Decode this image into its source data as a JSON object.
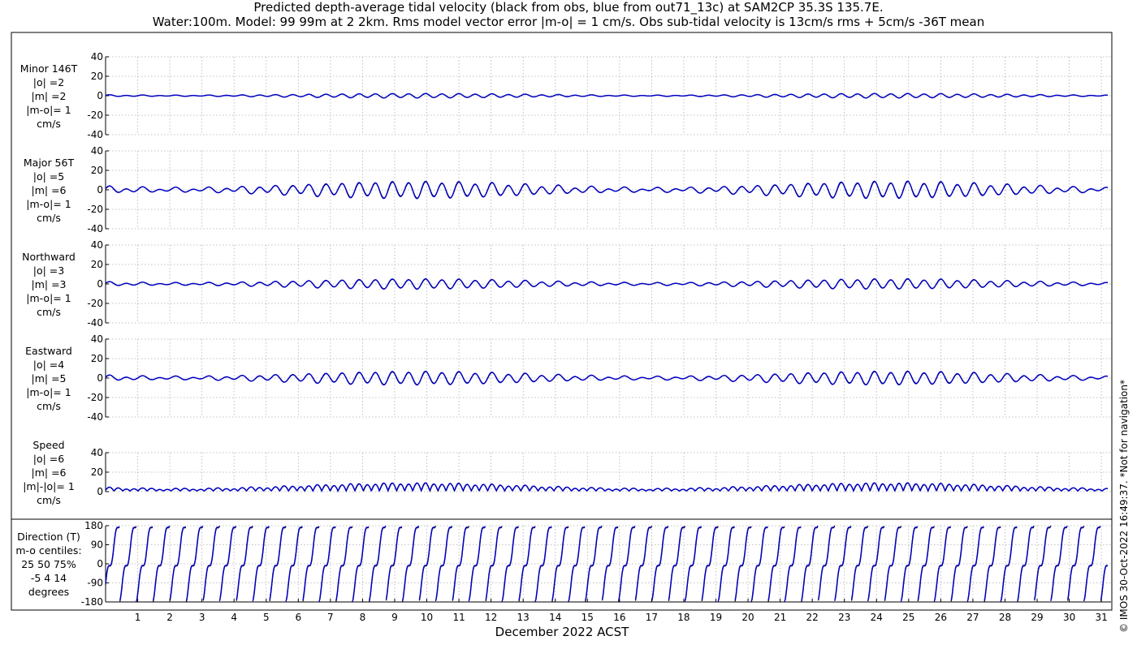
{
  "title_line1": "Predicted depth-average tidal velocity (black from obs, blue from out71_13c) at SAM2CP 35.3S 135.7E.",
  "title_line2": "Water:100m. Model: 99 99m at 2 2km. Rms model vector error |m-o| = 1 cm/s. Obs sub-tidal velocity is 13cm/s rms + 5cm/s -36T mean",
  "copyright": "© IMOS 30-Oct-2022 16:49:37. *Not for navigation*",
  "colors": {
    "obs": "#000000",
    "model": "#0000cc",
    "grid": "#b0b0b0"
  },
  "chart_data": [
    {
      "type": "line",
      "name": "minor",
      "label_lines": [
        "Minor 146T",
        "|o| =2",
        "|m| =2",
        "|m-o|= 1",
        "cm/s"
      ],
      "ylim": [
        -40,
        40
      ],
      "yticks": [
        40,
        20,
        0,
        -20,
        -40
      ],
      "ytick_labels": [
        "40",
        "20",
        "0",
        "-20",
        "-40"
      ],
      "amp_m2": 1.6,
      "amp_s2": 0.8,
      "mean": 0,
      "series": [
        {
          "name": "black from obs"
        },
        {
          "name": "blue from out71_13c"
        }
      ]
    },
    {
      "type": "line",
      "name": "major",
      "label_lines": [
        "Major 56T",
        "|o| =5",
        "|m| =6",
        "|m-o|= 1",
        "cm/s"
      ],
      "ylim": [
        -40,
        40
      ],
      "yticks": [
        40,
        20,
        0,
        -20,
        -40
      ],
      "ytick_labels": [
        "40",
        "20",
        "0",
        "-20",
        "-40"
      ],
      "amp_m2": 6,
      "amp_s2": 3.6,
      "mean": 0,
      "series": [
        {
          "name": "black from obs"
        },
        {
          "name": "blue from out71_13c"
        }
      ]
    },
    {
      "type": "line",
      "name": "northward",
      "label_lines": [
        "Northward",
        "|o| =3",
        "|m| =3",
        "|m-o|= 1",
        "cm/s"
      ],
      "ylim": [
        -40,
        40
      ],
      "yticks": [
        40,
        20,
        0,
        -20,
        -40
      ],
      "ytick_labels": [
        "40",
        "20",
        "0",
        "-20",
        "-40"
      ],
      "amp_m2": 3.6,
      "amp_s2": 2,
      "mean": 0,
      "series": [
        {
          "name": "black from obs"
        },
        {
          "name": "blue from out71_13c"
        }
      ]
    },
    {
      "type": "line",
      "name": "eastward",
      "label_lines": [
        "Eastward",
        "|o| =4",
        "|m| =5",
        "|m-o|= 1",
        "cm/s"
      ],
      "ylim": [
        -40,
        40
      ],
      "yticks": [
        40,
        20,
        0,
        -20,
        -40
      ],
      "ytick_labels": [
        "40",
        "20",
        "0",
        "-20",
        "-40"
      ],
      "amp_m2": 4.8,
      "amp_s2": 2.6,
      "mean": 0,
      "series": [
        {
          "name": "black from obs"
        },
        {
          "name": "blue from out71_13c"
        }
      ]
    },
    {
      "type": "line",
      "name": "speed",
      "label_lines": [
        "Speed",
        "|o| =6",
        "|m| =6",
        "|m|-|o|= 1",
        "cm/s"
      ],
      "ylim": [
        0,
        40
      ],
      "yticks": [
        40,
        20,
        0
      ],
      "ytick_labels": [
        "40",
        "20",
        "0"
      ],
      "amp_m2": 6,
      "amp_s2": 3.4,
      "mean": 0,
      "series": [
        {
          "name": "black from obs"
        },
        {
          "name": "blue from out71_13c"
        }
      ]
    },
    {
      "type": "line",
      "name": "direction",
      "label_lines": [
        "Direction (T)",
        "m-o centiles:",
        "25  50  75%",
        "-5   4  14",
        "degrees"
      ],
      "ylim": [
        -180,
        180
      ],
      "yticks": [
        180,
        90,
        0,
        -90,
        -180
      ],
      "ytick_labels": [
        "180",
        "90",
        "0",
        "-90",
        "-180"
      ],
      "series": [
        {
          "name": "black from obs"
        },
        {
          "name": "blue from out71_13c"
        }
      ]
    }
  ],
  "xaxis": {
    "label": "December 2022 ACST",
    "xlim": [
      0,
      31.3
    ],
    "ticks": [
      1,
      2,
      3,
      4,
      5,
      6,
      7,
      8,
      9,
      10,
      11,
      12,
      13,
      14,
      15,
      16,
      17,
      18,
      19,
      20,
      21,
      22,
      23,
      24,
      25,
      26,
      27,
      28,
      29,
      30,
      31
    ],
    "tick_labels": [
      "1",
      "2",
      "3",
      "4",
      "5",
      "6",
      "7",
      "8",
      "9",
      "10",
      "11",
      "12",
      "13",
      "14",
      "15",
      "16",
      "17",
      "18",
      "19",
      "20",
      "21",
      "22",
      "23",
      "24",
      "25",
      "26",
      "27",
      "28",
      "29",
      "30",
      "31"
    ]
  }
}
